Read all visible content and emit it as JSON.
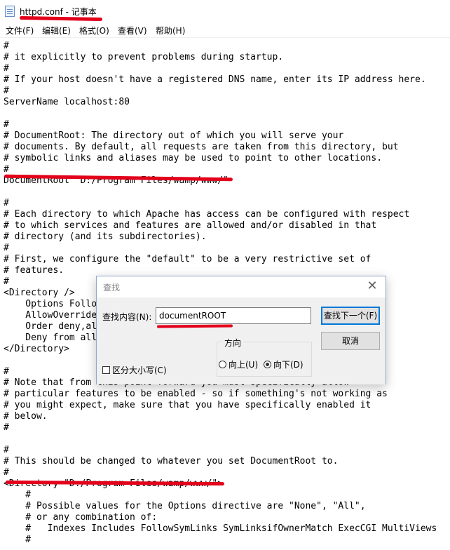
{
  "window": {
    "title": "httpd.conf - 记事本"
  },
  "menu": [
    "文件(F)",
    "编辑(E)",
    "格式(O)",
    "查看(V)",
    "帮助(H)"
  ],
  "editor": {
    "lines": [
      "#",
      "# it explicitly to prevent problems during startup.",
      "#",
      "# If your host doesn't have a registered DNS name, enter its IP address here.",
      "#",
      "ServerName localhost:80",
      "",
      "#",
      "# DocumentRoot: The directory out of which you will serve your",
      "# documents. By default, all requests are taken from this directory, but",
      "# symbolic links and aliases may be used to point to other locations.",
      "#",
      "DocumentRoot \"D:/Program Files/wamp/www/\"",
      "",
      "#",
      "# Each directory to which Apache has access can be configured with respect",
      "# to which services and features are allowed and/or disabled in that",
      "# directory (and its subdirectories).",
      "#",
      "# First, we configure the \"default\" to be a very restrictive set of",
      "# features.",
      "#",
      "<Directory />",
      "    Options FollowSymLinks",
      "    AllowOverride None",
      "    Order deny,allow",
      "    Deny from all",
      "</Directory>",
      "",
      "#",
      "# Note that from this point forward you must specifically allow",
      "# particular features to be enabled - so if something's not working as",
      "# you might expect, make sure that you have specifically enabled it",
      "# below.",
      "#",
      "",
      "#",
      "# This should be changed to whatever you set DocumentRoot to.",
      "#",
      "<Directory \"D:/Program Files/wamp/www/\">",
      "    #",
      "    # Possible values for the Options directive are \"None\", \"All\",",
      "    # or any combination of:",
      "    #   Indexes Includes FollowSymLinks SymLinksifOwnerMatch ExecCGI MultiViews",
      "    #"
    ]
  },
  "find_dialog": {
    "title": "查找",
    "find_label": "查找内容(N):",
    "find_value": "documentROOT",
    "find_next_label": "查找下一个(F)",
    "cancel_label": "取消",
    "direction_label": "方向",
    "up_label": "向上(U)",
    "down_label": "向下(D)",
    "match_case_label": "区分大小写(C)",
    "direction_selected": "down",
    "match_case_checked": false
  },
  "colors": {
    "annotation": "#e3001b",
    "default_button_border": "#0078d7"
  }
}
